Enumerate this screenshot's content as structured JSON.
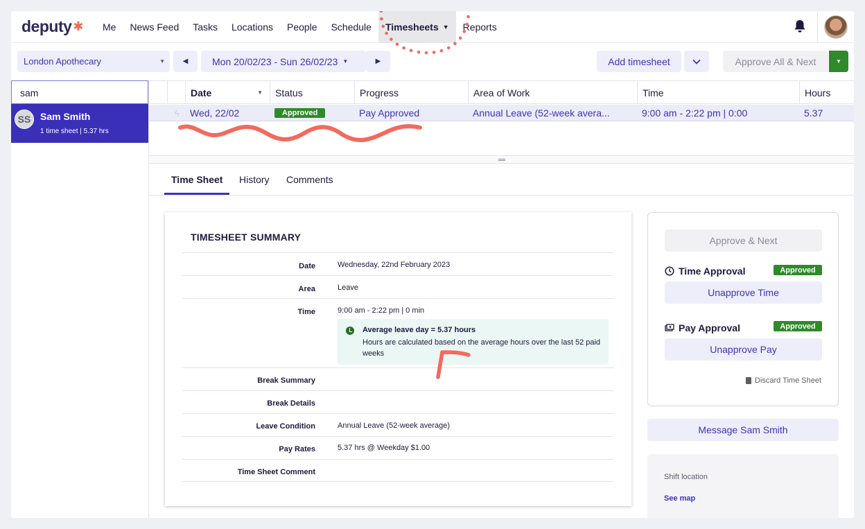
{
  "nav": {
    "logo": "deputy",
    "items": [
      "Me",
      "News Feed",
      "Tasks",
      "Locations",
      "People",
      "Schedule",
      "Timesheets",
      "Reports"
    ]
  },
  "toolbar": {
    "location": "London Apothecary",
    "date_range": "Mon 20/02/23 - Sun 26/02/23",
    "add_timesheet": "Add timesheet",
    "approve_all_next": "Approve All & Next"
  },
  "search": {
    "value": "sam"
  },
  "employee": {
    "initials": "SS",
    "name": "Sam Smith",
    "summary": "1 time sheet | 5.37 hrs"
  },
  "table": {
    "headers": [
      "Date",
      "Status",
      "Progress",
      "Area of Work",
      "Time",
      "Hours"
    ],
    "row": {
      "date": "Wed, 22/02",
      "status": "Approved",
      "progress": "Pay Approved",
      "area": "Annual Leave (52-week avera...",
      "time": "9:00 am - 2:22 pm | 0:00",
      "hours": "5.37"
    }
  },
  "tabs": [
    "Time Sheet",
    "History",
    "Comments"
  ],
  "summary": {
    "title": "TIMESHEET SUMMARY",
    "rows": [
      {
        "label": "Date",
        "value": "Wednesday, 22nd February 2023"
      },
      {
        "label": "Area",
        "value": "Leave"
      },
      {
        "label": "Time",
        "value": "9:00 am - 2:22 pm | 0 min"
      },
      {
        "label": "Break Summary",
        "value": ""
      },
      {
        "label": "Break Details",
        "value": ""
      },
      {
        "label": "Leave Condition",
        "value": "Annual Leave (52-week average)"
      },
      {
        "label": "Pay Rates",
        "value": "5.37 hrs @ Weekday $1.00"
      },
      {
        "label": "Time Sheet Comment",
        "value": ""
      }
    ],
    "info_title": "Average leave day = 5.37 hours",
    "info_body": "Hours are calculated based on the average hours over the last 52 paid weeks"
  },
  "approval": {
    "approve_next": "Approve & Next",
    "time_title": "Time Approval",
    "time_badge": "Approved",
    "unapprove_time": "Unapprove Time",
    "pay_title": "Pay Approval",
    "pay_badge": "Approved",
    "unapprove_pay": "Unapprove Pay",
    "discard": "Discard Time Sheet"
  },
  "message_button": "Message Sam Smith",
  "shift_location": {
    "title": "Shift location",
    "link": "See map"
  },
  "colors": {
    "accent": "#3b34b4",
    "approved": "#2f8a2a",
    "annotation": "#f26a5e"
  }
}
